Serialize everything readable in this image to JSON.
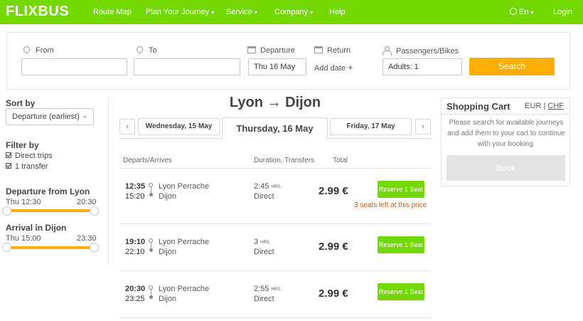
{
  "nav": {
    "logo": "FLIXBUS",
    "items": [
      {
        "label": "Route Map",
        "dropdown": false
      },
      {
        "label": "Plan Your Journey",
        "dropdown": true
      },
      {
        "label": "Service",
        "dropdown": true
      },
      {
        "label": "Company",
        "dropdown": true
      },
      {
        "label": "Help",
        "dropdown": false
      }
    ],
    "language": "En",
    "login": "Login",
    "brand_color": "#73d700"
  },
  "search": {
    "from_label": "From",
    "from_value": "",
    "to_label": "To",
    "to_value": "",
    "departure_label": "Departure",
    "departure_value": "Thu 16 May",
    "return_label": "Return",
    "add_date": "Add date",
    "passengers_label": "Passengers/Bikes",
    "passengers_value": "Adults: 1",
    "search_button": "Search",
    "accent_color": "#ffad00"
  },
  "sidebar": {
    "sort_heading": "Sort by",
    "sort_value": "Departure (earliest)",
    "filter_heading": "Filter by",
    "filters": [
      {
        "label": "Direct trips",
        "checked": true
      },
      {
        "label": "1 transfer",
        "checked": true
      }
    ],
    "departure_heading": "Departure from Lyon",
    "departure_min": "Thu 12:30",
    "departure_max": "20:30",
    "arrival_heading": "Arrival in Dijon",
    "arrival_min": "Thu 15:00",
    "arrival_max": "23:30"
  },
  "results": {
    "route_title": "Lyon → Dijon",
    "prev_day": "Wednesday, 15 May",
    "current_day": "Thursday, 16 May",
    "next_day": "Friday, 17 May",
    "columns": {
      "departs_arrives": "Departs/Arrives",
      "duration_transfers": "Duration, Transfers",
      "total": "Total"
    },
    "trips": [
      {
        "dep": "12:35",
        "arr": "15:20",
        "from": "Lyon Perrache",
        "to": "Dijon",
        "duration": "2:45",
        "duration_unit": "HRS.",
        "transfers": "Direct",
        "price": "2.99 €",
        "button": "Reserve 1 Seat",
        "note": "3 seats left at this price"
      },
      {
        "dep": "19:10",
        "arr": "22:10",
        "from": "Lyon Perrache",
        "to": "Dijon",
        "duration": "3",
        "duration_unit": "HRS.",
        "transfers": "Direct",
        "price": "2.99 €",
        "button": "Reserve 1 Seat",
        "note": ""
      },
      {
        "dep": "20:30",
        "arr": "23:25",
        "from": "Lyon Perrache",
        "to": "Dijon",
        "duration": "2:55",
        "duration_unit": "HRS.",
        "transfers": "Direct",
        "price": "2.99 €",
        "button": "Reserve 1 Seat",
        "note": ""
      }
    ]
  },
  "cart": {
    "title": "Shopping Cart",
    "currency_a": "EUR",
    "currency_sep": "|",
    "currency_b": "CHF",
    "message": "Please search for available journeys and add them to your cart to continue with your booking.",
    "book_button": "Book"
  }
}
